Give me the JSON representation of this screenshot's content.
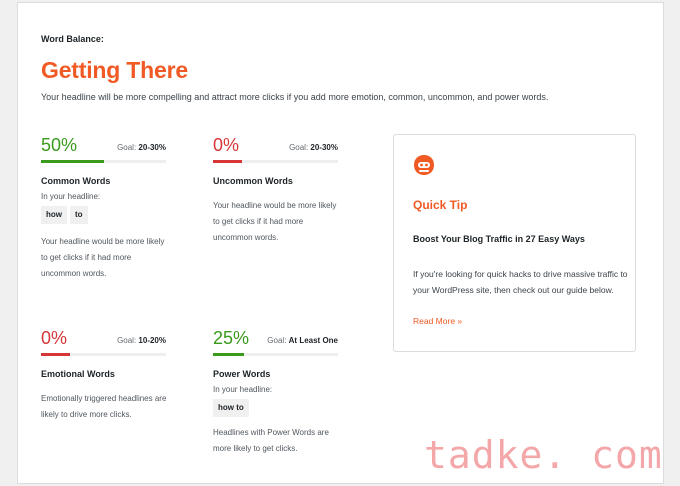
{
  "header": {
    "eyebrow": "Word Balance:",
    "title": "Getting There",
    "description": "Your headline will be more compelling and attract more clicks if you add more emotion, common, uncommon, and power words."
  },
  "metrics": [
    {
      "percent": "50%",
      "goal_label": "Goal:",
      "goal_value": "20-30%",
      "name": "Common Words",
      "sublabel": "In your headline:",
      "chips": [
        "how",
        "to"
      ],
      "description": "Your headline would be more likely to get clicks if it had more uncommon words.",
      "level": 0.5,
      "status": "good"
    },
    {
      "percent": "0%",
      "goal_label": "Goal:",
      "goal_value": "20-30%",
      "name": "Uncommon Words",
      "description": "Your headline would be more likely to get clicks if it had more uncommon words.",
      "level": 0,
      "status": "bad"
    },
    {
      "percent": "0%",
      "goal_label": "Goal:",
      "goal_value": "10-20%",
      "name": "Emotional Words",
      "description": "Emotionally triggered headlines are likely to drive more clicks.",
      "level": 0,
      "status": "bad"
    },
    {
      "percent": "25%",
      "goal_label": "Goal:",
      "goal_value": "At Least One",
      "name": "Power Words",
      "sublabel": "In your headline:",
      "chips": [
        "how to"
      ],
      "description": "Headlines with Power Words are more likely to get clicks.",
      "level": 0.25,
      "status": "good"
    }
  ],
  "tip": {
    "icon": "wpbeginner-logo-icon",
    "title": "Quick Tip",
    "heading": "Boost Your Blog Traffic in 27 Easy Ways",
    "body": "If you're looking for quick hacks to drive massive traffic to your WordPress site, then check out our guide below.",
    "link": "Read More »"
  },
  "watermark": "tadke. com",
  "colors": {
    "accent": "#f15a24",
    "good": "#3a9a1c",
    "bad": "#d63638"
  }
}
